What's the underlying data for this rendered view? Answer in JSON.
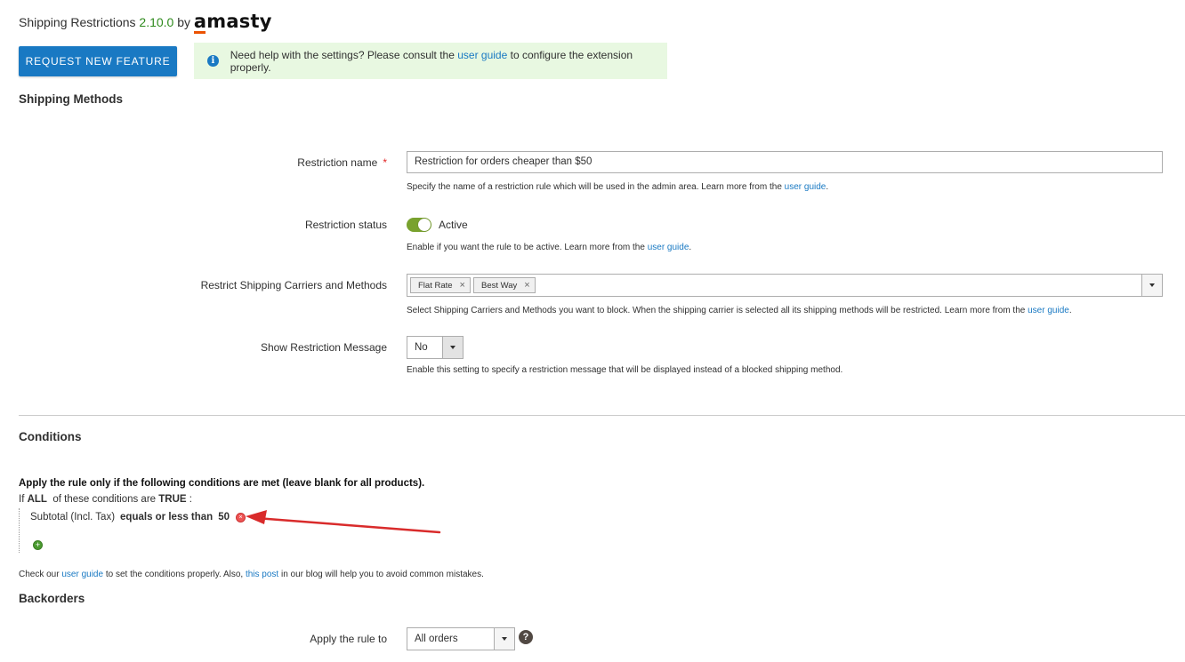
{
  "header": {
    "ext_name": "Shipping Restrictions",
    "version": "2.10.0",
    "by": "by",
    "brand": "amasty"
  },
  "actions": {
    "request_feature_label": "Request New Feature"
  },
  "notice": {
    "text_before": "Need help with the settings? Please consult the ",
    "link_text": "user guide",
    "text_after": " to configure the extension properly."
  },
  "shipping_methods": {
    "title": "Shipping Methods",
    "restriction_name": {
      "label": "Restriction name",
      "value": "Restriction for orders cheaper than $50",
      "hint_before": "Specify the name of a restriction rule which will be used in the admin area. Learn more from the ",
      "hint_link": "user guide",
      "hint_after": "."
    },
    "restriction_status": {
      "label": "Restriction status",
      "value": "Active",
      "hint_before": "Enable if you want the rule to be active. Learn more from the ",
      "hint_link": "user guide",
      "hint_after": "."
    },
    "carriers": {
      "label": "Restrict Shipping Carriers and Methods",
      "selected": [
        "Flat Rate",
        "Best Way"
      ],
      "hint_before": "Select Shipping Carriers and Methods you want to block. When the shipping carrier is selected all its shipping methods will be restricted. Learn more from the ",
      "hint_link": "user guide",
      "hint_after": "."
    },
    "show_message": {
      "label": "Show Restriction Message",
      "value": "No",
      "hint": "Enable this setting to specify a restriction message that will be displayed instead of a blocked shipping method."
    }
  },
  "conditions": {
    "title": "Conditions",
    "heading": "Apply the rule only if the following conditions are met (leave blank for all products).",
    "if_prefix": "If ",
    "aggregator": "ALL",
    "if_middle": "  of these conditions are ",
    "value": "TRUE",
    "if_suffix": " :",
    "rule": {
      "attribute": "Subtotal (Incl. Tax)",
      "operator": "equals or less than",
      "value": "50"
    },
    "footer_before": "Check our ",
    "footer_link1": "user guide",
    "footer_middle": " to set the conditions properly. Also, ",
    "footer_link2": "this post",
    "footer_after": " in our blog will help you to avoid common mistakes."
  },
  "backorders": {
    "title": "Backorders",
    "apply_label": "Apply the rule to",
    "apply_value": "All orders"
  },
  "colors": {
    "primary": "#1979c3",
    "version_green": "#2e8a1c",
    "toggle_on": "#79a22e",
    "notice_bg": "#e8f8e1",
    "arrow_red": "#d92b2b"
  }
}
